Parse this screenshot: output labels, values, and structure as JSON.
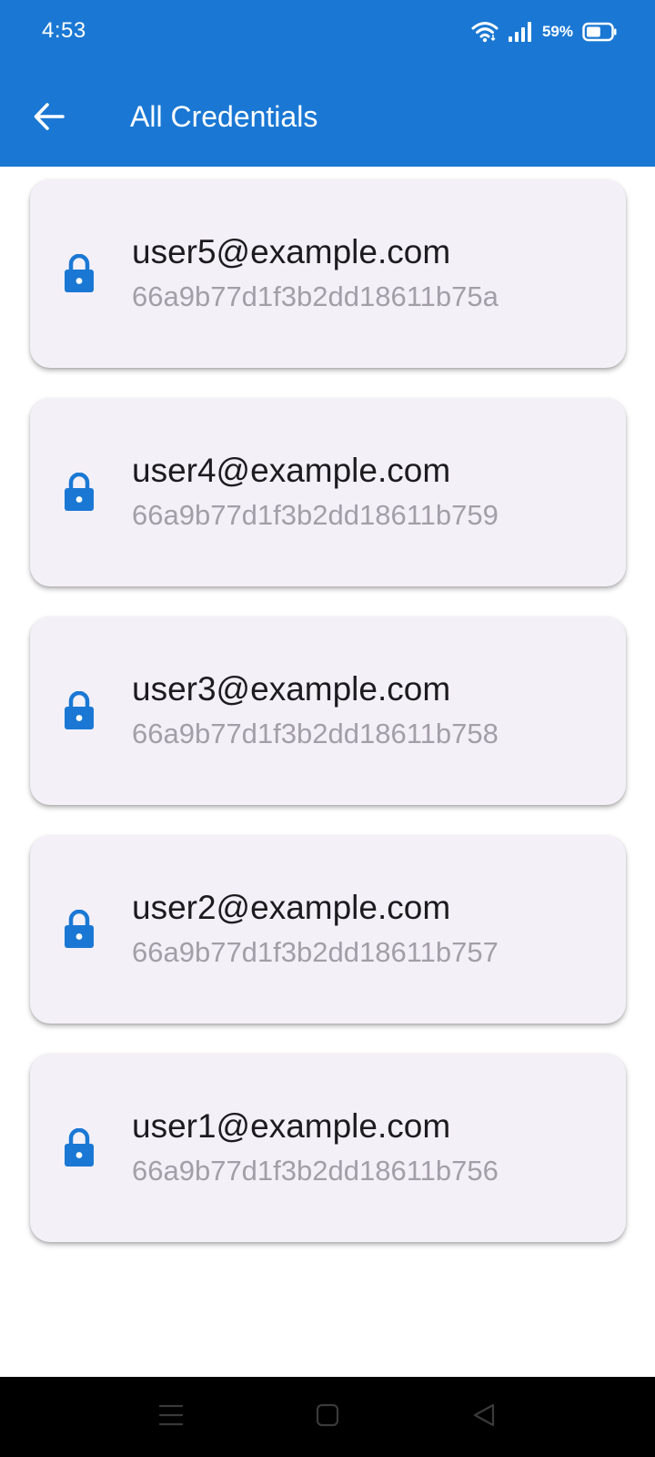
{
  "status_bar": {
    "time": "4:53",
    "battery_percent": "59%",
    "battery_level": 0.59,
    "icons": [
      "wifi-icon",
      "signal-icon",
      "battery-icon"
    ]
  },
  "app_bar": {
    "title": "All Credentials",
    "back_icon": "arrow-left-icon"
  },
  "colors": {
    "primary": "#1a78d4",
    "card_background": "#f4f0f8",
    "email_text": "#1c1b1f",
    "id_text": "#a39fa8"
  },
  "credentials": [
    {
      "email": "user5@example.com",
      "id": "66a9b77d1f3b2dd18611b75a",
      "icon": "lock-icon"
    },
    {
      "email": "user4@example.com",
      "id": "66a9b77d1f3b2dd18611b759",
      "icon": "lock-icon"
    },
    {
      "email": "user3@example.com",
      "id": "66a9b77d1f3b2dd18611b758",
      "icon": "lock-icon"
    },
    {
      "email": "user2@example.com",
      "id": "66a9b77d1f3b2dd18611b757",
      "icon": "lock-icon"
    },
    {
      "email": "user1@example.com",
      "id": "66a9b77d1f3b2dd18611b756",
      "icon": "lock-icon"
    }
  ],
  "nav_bar": {
    "icons": [
      "menu-icon",
      "home-icon",
      "back-triangle-icon"
    ]
  }
}
